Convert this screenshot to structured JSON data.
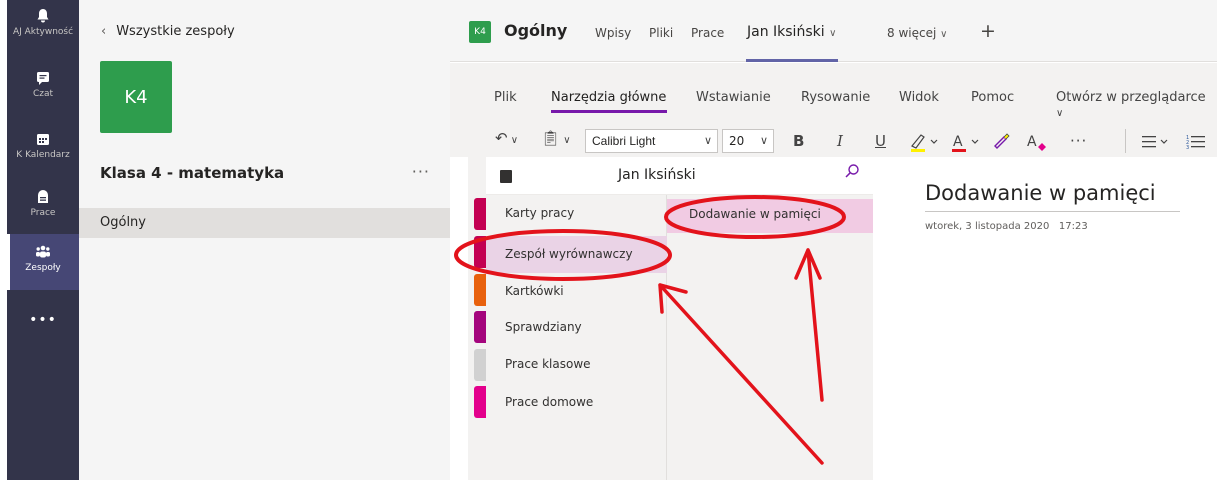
{
  "rail": {
    "items": [
      {
        "label": "Aktywność",
        "prefix": "AJ",
        "icon": "bell-icon"
      },
      {
        "label": "Czat",
        "icon": "chat-icon"
      },
      {
        "label": "Kalendarz",
        "prefix": "K",
        "icon": "calendar-icon"
      },
      {
        "label": "Prace",
        "icon": "assignments-icon"
      },
      {
        "label": "Zespoły",
        "icon": "teams-icon"
      }
    ],
    "more": "•••"
  },
  "team_panel": {
    "back_label": "Wszystkie zespoły",
    "avatar": "K4",
    "team_name": "Klasa 4 - matematyka",
    "more": "···",
    "channel": "Ogólny"
  },
  "header": {
    "avatar": "K4",
    "title": "Ogólny",
    "tabs": [
      "Wpisy",
      "Pliki",
      "Prace",
      "Jan Iksiński",
      "8 więcej"
    ],
    "plus": "+"
  },
  "ribbon": {
    "tabs": [
      "Plik",
      "Narzędzia główne",
      "Wstawianie",
      "Rysowanie",
      "Widok",
      "Pomoc",
      "Otwórz w przeglądarce"
    ],
    "font": "Calibri Light",
    "size": "20",
    "bold": "B",
    "italic": "I",
    "underline": "U",
    "more": "···"
  },
  "notebook": {
    "title": "Jan Iksiński",
    "sections": [
      "Karty pracy",
      "Zespół wyrównawczy",
      "Kartkówki",
      "Sprawdziany",
      "Prace klasowe",
      "Prace domowe"
    ],
    "section_colors": [
      "#c30052",
      "#c30052",
      "#e8610d",
      "#a4057d",
      "#d1d1d1",
      "#e3008c"
    ],
    "page": "Dodawanie w pamięci",
    "page_title": "Dodawanie w pamięci",
    "page_date": "wtorek, 3 listopada 2020",
    "page_time": "17:23"
  },
  "colors": {
    "rail": "#33344a",
    "team_green": "#2e9d4d",
    "accent": "#6264a7",
    "onenote": "#7719aa",
    "annotation": "#e3131b"
  }
}
